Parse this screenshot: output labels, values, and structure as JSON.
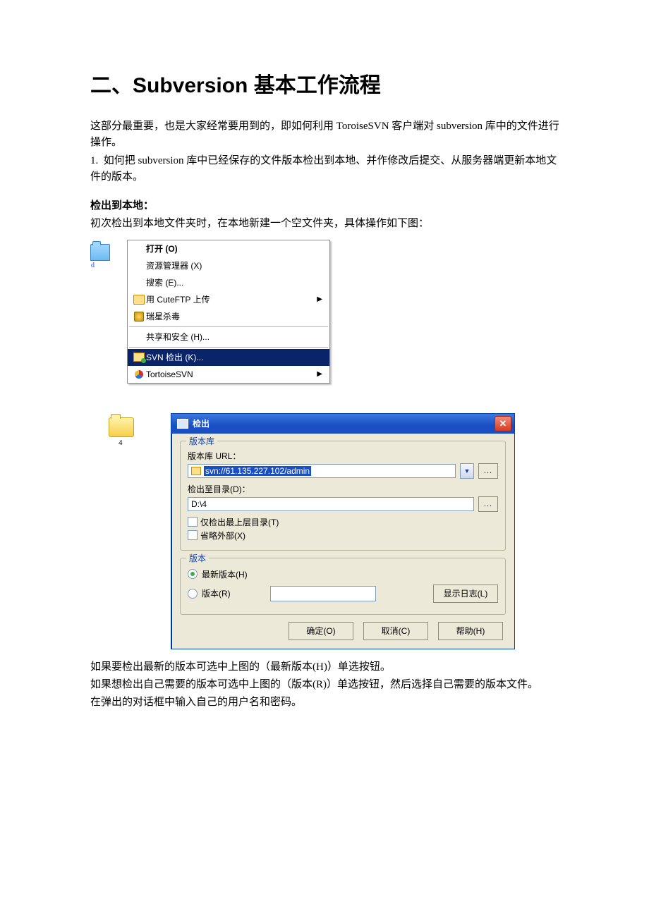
{
  "heading": "二、Subversion 基本工作流程",
  "intro1": "这部分最重要，也是大家经常要用到的，即如何利用 ToroiseSVN 客户端对 subversion 库中的文件进行操作。",
  "intro2_prefix": "1.",
  "intro2": "如何把 subversion 库中已经保存的文件版本检出到本地、并作修改后提交、从服务器端更新本地文件的版本。",
  "sec1_title": "检出到本地：",
  "sec1_body": "初次检出到本地文件夹时，在本地新建一个空文件夹，具体操作如下图：",
  "context_menu": {
    "open": "打开 (O)",
    "explorer": "资源管理器 (X)",
    "search": "搜索 (E)...",
    "cuteftp": "用 CuteFTP 上传",
    "rising": "瑞星杀毒",
    "share": "共享和安全 (H)...",
    "svn_checkout": "SVN 检出 (K)...",
    "tortoisesvn": "TortoiseSVN"
  },
  "folder_d_label": "d",
  "folder_4_label": "4",
  "dialog": {
    "title": "检出",
    "group_repo": "版本库",
    "url_label": "版本库 URL：",
    "url_value": "svn://61.135.227.102/admin",
    "dir_label": "检出至目录(D)：",
    "dir_value": "D:\\4",
    "chk_top": "仅检出最上层目录(T)",
    "chk_ext": "省略外部(X)",
    "group_rev": "版本",
    "radio_head": "最新版本(H)",
    "radio_rev": "版本(R)",
    "btn_log": "显示日志(L)",
    "btn_ok": "确定(O)",
    "btn_cancel": "取消(C)",
    "btn_help": "帮助(H)",
    "browse": "..."
  },
  "after1": "如果要检出最新的版本可选中上图的（最新版本(H)）单选按钮。",
  "after2": "如果想检出自己需要的版本可选中上图的（版本(R)）单选按钮，然后选择自己需要的版本文件。",
  "after3": "在弹出的对话框中输入自己的用户名和密码。"
}
